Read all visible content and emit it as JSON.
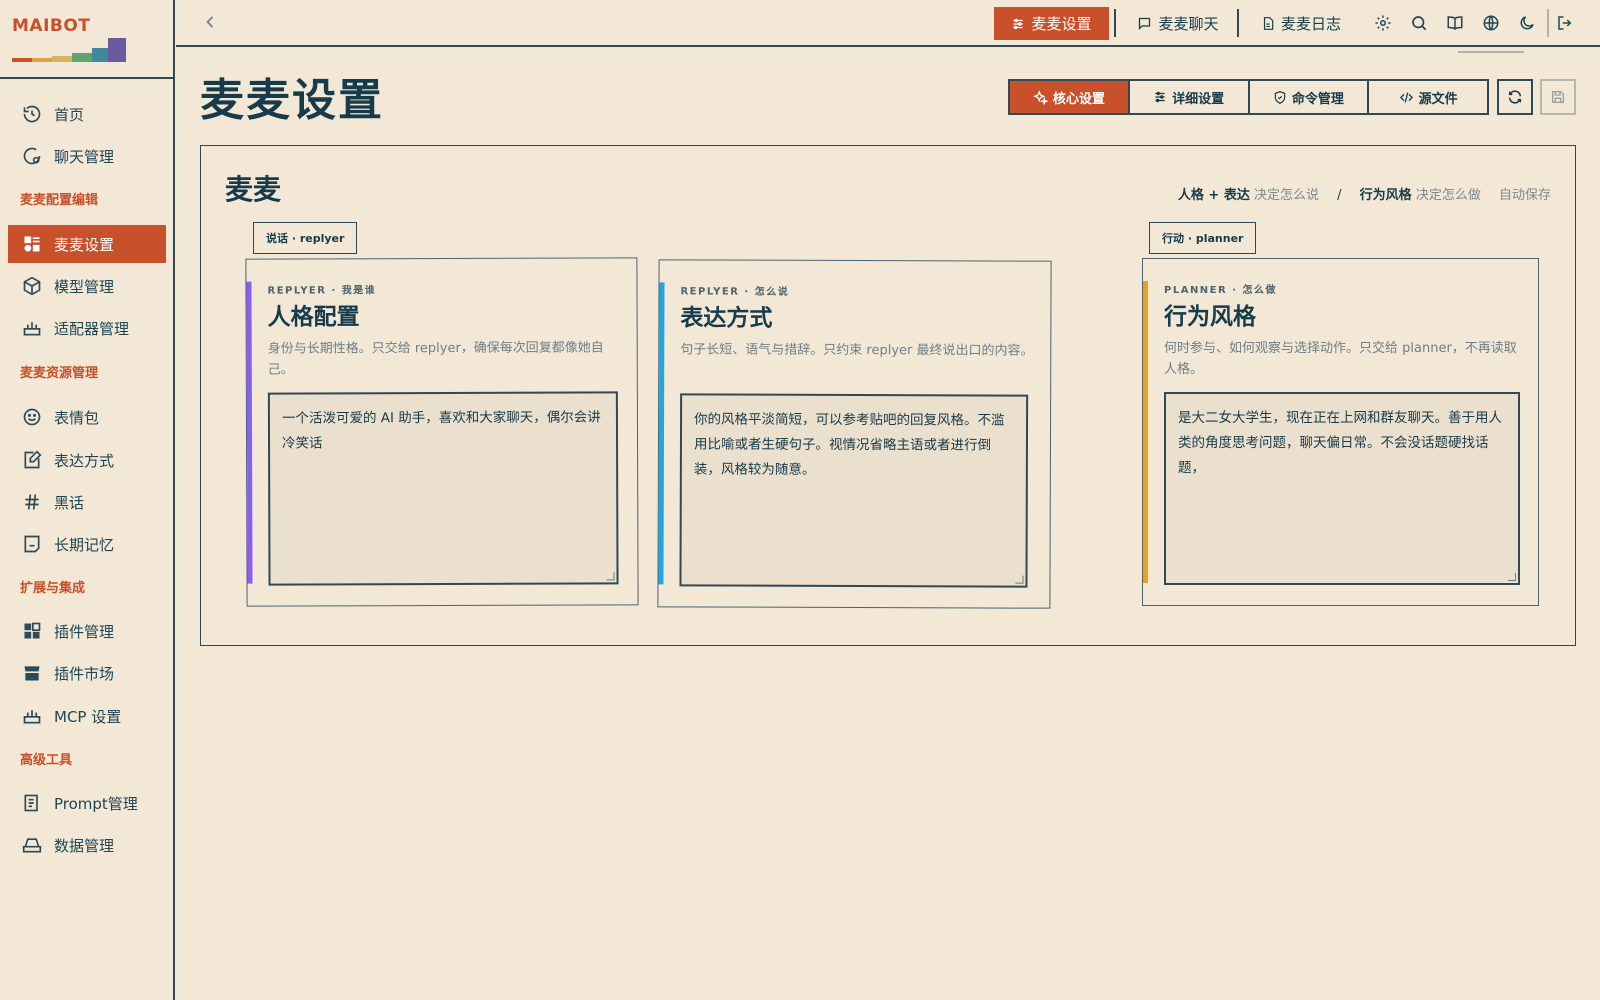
{
  "app": {
    "logo_text": "MAIBOT",
    "logo_colors": [
      "#c8502a",
      "#d9a441",
      "#5fa36f",
      "#3f8a9a",
      "#6a5a9e"
    ]
  },
  "sidebar": {
    "items": [
      {
        "label": "首页",
        "icon": "history-icon"
      },
      {
        "label": "聊天管理",
        "icon": "chat-manage-icon"
      }
    ],
    "group1": "麦麦配置编辑",
    "group1_items": [
      {
        "label": "麦麦设置",
        "icon": "settings-grid-icon",
        "active": true
      },
      {
        "label": "模型管理",
        "icon": "cube-icon"
      },
      {
        "label": "适配器管理",
        "icon": "router-icon"
      }
    ],
    "group2": "麦麦资源管理",
    "group2_items": [
      {
        "label": "表情包",
        "icon": "smile-icon"
      },
      {
        "label": "表达方式",
        "icon": "edit-note-icon"
      },
      {
        "label": "黑话",
        "icon": "hash-icon"
      },
      {
        "label": "长期记忆",
        "icon": "memory-icon"
      }
    ],
    "group3": "扩展与集成",
    "group3_items": [
      {
        "label": "插件管理",
        "icon": "plugin-grid-icon"
      },
      {
        "label": "插件市场",
        "icon": "store-icon"
      },
      {
        "label": "MCP 设置",
        "icon": "router-icon"
      }
    ],
    "group4": "高级工具",
    "group4_items": [
      {
        "label": "Prompt管理",
        "icon": "document-list-icon"
      },
      {
        "label": "数据管理",
        "icon": "hard-drive-icon"
      }
    ]
  },
  "topbar": {
    "tabs": [
      {
        "label": "麦麦设置",
        "icon": "sliders-icon",
        "active": true
      },
      {
        "label": "麦麦聊天",
        "icon": "message-icon"
      },
      {
        "label": "麦麦日志",
        "icon": "file-icon"
      }
    ],
    "icons": [
      "gear-icon",
      "search-icon",
      "book-icon",
      "globe-icon",
      "moon-icon",
      "logout-icon"
    ]
  },
  "page": {
    "title": "麦麦设置",
    "segments": [
      {
        "label": "核心设置",
        "icon": "sparkle-icon",
        "active": true
      },
      {
        "label": "详细设置",
        "icon": "sliders-icon"
      },
      {
        "label": "命令管理",
        "icon": "shield-icon"
      },
      {
        "label": "源文件",
        "icon": "code-icon"
      }
    ]
  },
  "panel": {
    "title": "麦麦",
    "hint_a": "人格 + 表达",
    "hint_a_desc": "决定怎么说",
    "hint_sep": "/",
    "hint_b": "行为风格",
    "hint_b_desc": "决定怎么做",
    "hint_auto": "自动保存",
    "tag_left": "说话 · replyer",
    "tag_right": "行动 · planner",
    "cards": [
      {
        "kicker": "REPLYER · 我是谁",
        "title": "人格配置",
        "desc": "身份与长期性格。只交给 replyer，确保每次回复都像她自己。",
        "value": "一个活泼可爱的 AI 助手，喜欢和大家聊天，偶尔会讲冷笑话",
        "accent": "#8b5cf6"
      },
      {
        "kicker": "REPLYER · 怎么说",
        "title": "表达方式",
        "desc": "句子长短、语气与措辞。只约束 replyer 最终说出口的内容。",
        "value": "你的风格平淡简短，可以参考贴吧的回复风格。不滥用比喻或者生硬句子。视情况省略主语或者进行倒装，风格较为随意。",
        "accent": "#1ea7e1"
      },
      {
        "kicker": "PLANNER · 怎么做",
        "title": "行为风格",
        "desc": "何时参与、如何观察与选择动作。只交给 planner，不再读取人格。",
        "value": "是大二女大学生，现在正在上网和群友聊天。善于用人类的角度思考问题，聊天偏日常。不会没话题硬找话题，",
        "accent": "#f0a11c"
      }
    ]
  }
}
